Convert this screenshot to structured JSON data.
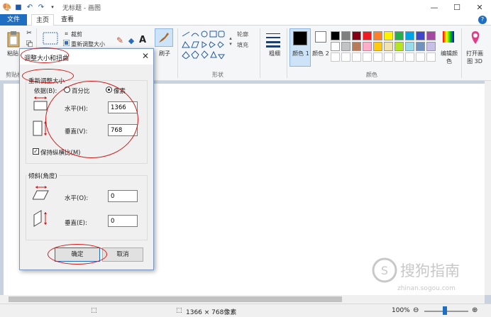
{
  "titlebar": {
    "app_title": "无标题 - 画图",
    "quick_access": [
      "paint-app-icon",
      "save-icon",
      "undo-icon",
      "redo-icon",
      "customize-qat-icon"
    ]
  },
  "tabs": {
    "file": "文件",
    "home": "主页",
    "view": "查看",
    "help": "?"
  },
  "ribbon": {
    "clipboard": {
      "paste": "粘贴",
      "label": "剪贴板"
    },
    "image": {
      "crop": "裁剪",
      "resize": "重新调整大小"
    },
    "tools": {
      "brush": "刷子"
    },
    "shapes": {
      "outline": "轮廓",
      "fill": "填充",
      "label": "形状"
    },
    "size": {
      "label": "粗细"
    },
    "colors": {
      "color1": "颜色 1",
      "color2": "颜色 2",
      "edit": "编辑颜色",
      "label": "颜色",
      "palette_row1": [
        "#000000",
        "#7f7f7f",
        "#880015",
        "#ed1c24",
        "#ff7f27",
        "#fff200",
        "#22b14c",
        "#00a2e8",
        "#3f48cc",
        "#a349a4"
      ],
      "palette_row2": [
        "#ffffff",
        "#c3c3c3",
        "#b97a57",
        "#ffaec9",
        "#ffc90e",
        "#efe4b0",
        "#b5e61d",
        "#99d9ea",
        "#7092be",
        "#c8bfe7"
      ]
    },
    "paint3d": "打开画图 3D"
  },
  "dialog": {
    "title": "调整大小和扭曲",
    "resize_group": "重新调整大小",
    "by_label": "依据(B):",
    "percent_label": "百分比",
    "pixels_label": "像素",
    "horizontal_label": "水平(H):",
    "horizontal_value": "1366",
    "vertical_label": "垂直(V):",
    "vertical_value": "768",
    "keep_ratio_label": "保持纵横比(M)",
    "skew_group": "倾斜(角度)",
    "skew_h_label": "水平(O):",
    "skew_h_value": "0",
    "skew_v_label": "垂直(E):",
    "skew_v_value": "0",
    "ok": "确定",
    "cancel": "取消"
  },
  "statusbar": {
    "canvas_size": "1366 × 768像素",
    "zoom": "100%"
  },
  "watermark": {
    "text": "搜狗指南",
    "url": "zhinan.sogou.com"
  }
}
